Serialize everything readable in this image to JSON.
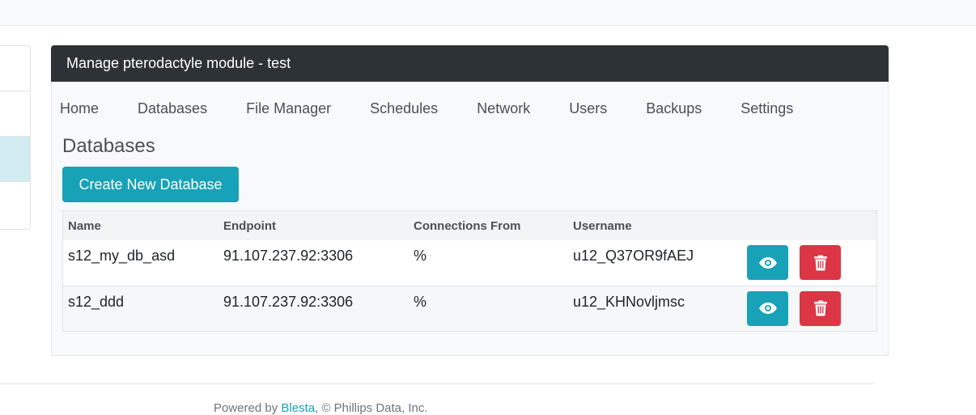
{
  "card": {
    "header_title": "Manage pterodactyle module - test"
  },
  "tabs": [
    {
      "label": "Home"
    },
    {
      "label": "Databases"
    },
    {
      "label": "File Manager"
    },
    {
      "label": "Schedules"
    },
    {
      "label": "Network"
    },
    {
      "label": "Users"
    },
    {
      "label": "Backups"
    },
    {
      "label": "Settings"
    }
  ],
  "section": {
    "title": "Databases",
    "create_button_label": "Create New Database"
  },
  "table": {
    "columns": [
      "Name",
      "Endpoint",
      "Connections From",
      "Username",
      ""
    ],
    "rows": [
      {
        "name": "s12_my_db_asd",
        "endpoint": "91.107.237.92:3306",
        "connections_from": "%",
        "username": "u12_Q37OR9fAEJ"
      },
      {
        "name": "s12_ddd",
        "endpoint": "91.107.237.92:3306",
        "connections_from": "%",
        "username": "u12_KHNovljmsc"
      }
    ]
  },
  "icons": {
    "view": "eye-icon",
    "delete": "trash-icon"
  },
  "colors": {
    "header_bg": "#2d3236",
    "primary": "#17a2b8",
    "danger": "#dc3545",
    "sidebar_active": "#d1ecf1"
  },
  "footer": {
    "prefix": "Powered by ",
    "link": "Blesta",
    "suffix": ", © Phillips Data, Inc."
  }
}
